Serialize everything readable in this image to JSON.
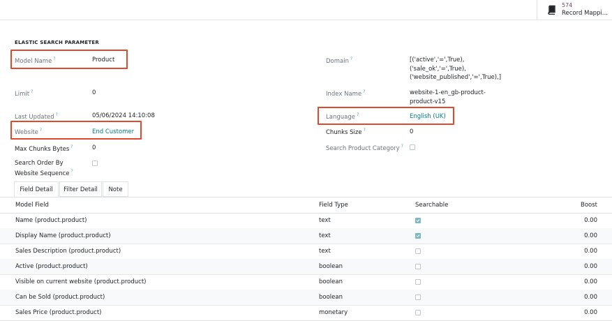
{
  "smart_button": {
    "count": "574",
    "label": "Record Mappi...",
    "icon": "book-icon"
  },
  "section_title": "ELASTIC SEARCH PARAMETER",
  "fields": {
    "model_name": {
      "label": "Model Name",
      "value": "Product"
    },
    "limit": {
      "label": "Limit",
      "value": "0"
    },
    "last_updated": {
      "label": "Last Updated",
      "value": "05/06/2024 14:10:08"
    },
    "website": {
      "label": "Website",
      "value": "End Customer"
    },
    "max_chunks_bytes": {
      "label": "Max Chunks Bytes",
      "value": "0"
    },
    "search_order": {
      "label_line1": "Search Order By",
      "label_line2": "Website Sequence",
      "checked": false
    },
    "domain": {
      "label": "Domain",
      "lines": [
        "[('active','=',True),",
        "('sale_ok','=',True),",
        "('website_published','=',True),]"
      ]
    },
    "index_name": {
      "label": "Index Name",
      "lines": [
        "website-1-en_gb-product-",
        "product-v15"
      ]
    },
    "language": {
      "label": "Language",
      "value": "English (UK)"
    },
    "chunks_size": {
      "label": "Chunks Size",
      "value": "0"
    },
    "search_product_category": {
      "label": "Search Product Category",
      "checked": false
    }
  },
  "help_mark": "?",
  "tabs": [
    "Field Detail",
    "Filter Detail",
    "Note"
  ],
  "active_tab": "Field Detail",
  "table": {
    "headers": {
      "model_field": "Model Field",
      "field_type": "Field Type",
      "searchable": "Searchable",
      "boost": "Boost"
    },
    "rows": [
      {
        "model_field": "Name (product.product)",
        "field_type": "text",
        "searchable": true,
        "boost": "0.00"
      },
      {
        "model_field": "Display Name (product.product)",
        "field_type": "text",
        "searchable": true,
        "boost": "0.00"
      },
      {
        "model_field": "Sales Description (product.product)",
        "field_type": "text",
        "searchable": false,
        "boost": "0.00"
      },
      {
        "model_field": "Active (product.product)",
        "field_type": "boolean",
        "searchable": false,
        "boost": "0.00"
      },
      {
        "model_field": "Visible on current website (product.product)",
        "field_type": "boolean",
        "searchable": false,
        "boost": "0.00"
      },
      {
        "model_field": "Can be Sold (product.product)",
        "field_type": "boolean",
        "searchable": false,
        "boost": "0.00"
      },
      {
        "model_field": "Sales Price (product.product)",
        "field_type": "monetary",
        "searchable": false,
        "boost": "0.00"
      }
    ]
  },
  "colors": {
    "highlight": "#e04a2c",
    "link": "#017e84",
    "accent": "#714b67",
    "checkbox_on": "#7fb9c0"
  }
}
